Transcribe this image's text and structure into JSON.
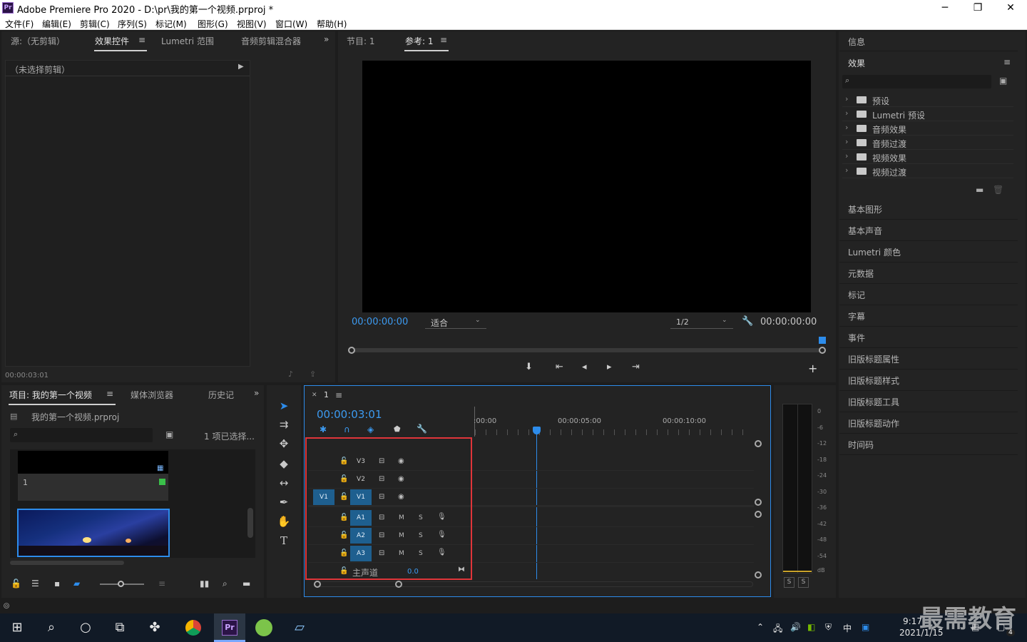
{
  "window": {
    "logo": "Pr",
    "title": "Adobe Premiere Pro 2020 - D:\\pr\\我的第一个视频.prproj *",
    "min_icon": "minimize-icon",
    "max_icon": "restore-icon",
    "close_icon": "close-icon"
  },
  "menu": [
    "文件(F)",
    "编辑(E)",
    "剪辑(C)",
    "序列(S)",
    "标记(M)",
    "图形(G)",
    "视图(V)",
    "窗口(W)",
    "帮助(H)"
  ],
  "source_panel": {
    "tabs": [
      "源:（无剪辑）",
      "效果控件",
      "Lumetri 范围",
      "音频剪辑混合器"
    ],
    "no_clip": "（未选择剪辑）",
    "timecode": "00:00:03:01"
  },
  "program_panel": {
    "tabs": [
      "节目: 1",
      "参考: 1"
    ],
    "timecode_left": "00:00:00:00",
    "fit": "适合",
    "resolution": "1/2",
    "timecode_right": "00:00:00:00"
  },
  "right_panel": {
    "info": "信息",
    "effects_title": "效果",
    "folders": [
      "预设",
      "Lumetri 预设",
      "音频效果",
      "音频过渡",
      "视频效果",
      "视频过渡"
    ],
    "list": [
      "基本图形",
      "基本声音",
      "Lumetri 颜色",
      "元数据",
      "标记",
      "字幕",
      "事件",
      "旧版标题属性",
      "旧版标题样式",
      "旧版标题工具",
      "旧版标题动作",
      "时间码"
    ]
  },
  "project_panel": {
    "tabs": [
      "项目: 我的第一个视频",
      "媒体浏览器",
      "历史记"
    ],
    "file": "我的第一个视频.prproj",
    "selection": "1 项已选择...",
    "clip_label": "1"
  },
  "timeline": {
    "tab": "1",
    "timecode": "00:00:03:01",
    "ruler": [
      ":00:00",
      "00:00:05:00",
      "00:00:10:00"
    ],
    "video_tracks": [
      "V3",
      "V2",
      "V1"
    ],
    "audio_tracks": [
      "A1",
      "A2",
      "A3"
    ],
    "source_patch": "V1",
    "master": "主声道",
    "master_value": "0.0",
    "mute": "M",
    "solo": "S"
  },
  "meters": {
    "scale": [
      "0",
      "-6",
      "-12",
      "-18",
      "-24",
      "-30",
      "-36",
      "-42",
      "-48",
      "-54",
      "dB"
    ],
    "solo": "S"
  },
  "taskbar": {
    "time": "9:17",
    "date": "2021/1/15",
    "ime": "中",
    "notif": "4",
    "watermark": "最需教育"
  },
  "colors": {
    "accent_blue": "#2d8ceb",
    "highlight_red": "#e0353a",
    "track_blue": "#1e5f8f"
  }
}
